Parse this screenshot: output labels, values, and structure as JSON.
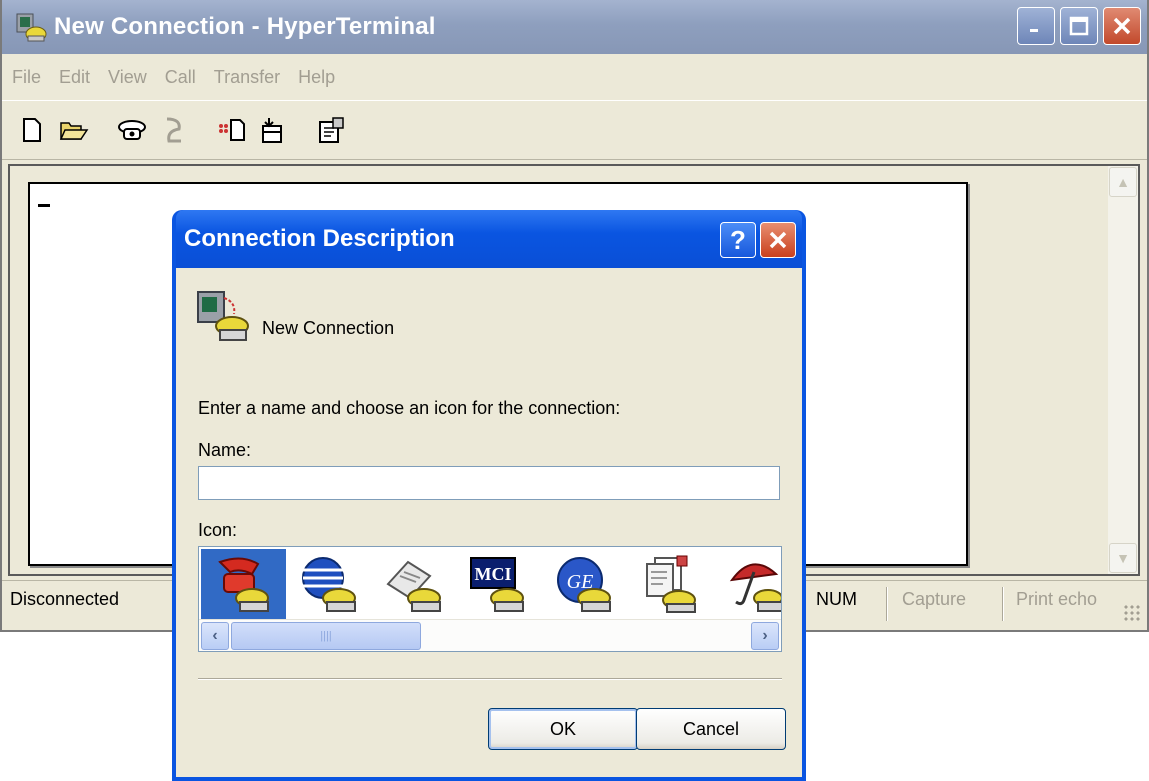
{
  "window": {
    "title": "New Connection - HyperTerminal",
    "menu": [
      "File",
      "Edit",
      "View",
      "Call",
      "Transfer",
      "Help"
    ],
    "status": {
      "connection": "Disconnected",
      "num": "NUM",
      "capture": "Capture",
      "print_echo": "Print echo"
    }
  },
  "toolbar_icons": [
    "new-icon",
    "open-icon",
    "call-icon",
    "disconnect-icon",
    "send-icon",
    "receive-icon",
    "properties-icon"
  ],
  "dialog": {
    "title": "Connection Description",
    "help_button": "?",
    "close_button": "✕",
    "header_label": "New Connection",
    "prompt": "Enter a name and choose an icon for the connection:",
    "name_label": "Name:",
    "name_value": "",
    "icon_label": "Icon:",
    "icons": [
      "phone-icon",
      "globe-icon",
      "fax-icon",
      "mci-icon",
      "ge-icon",
      "documents-icon",
      "umbrella-icon"
    ],
    "icon_mci_text": "MCI",
    "icon_ge_text": "GE",
    "ok": "OK",
    "cancel": "Cancel"
  },
  "colors": {
    "dialog_title_blue": "#0a55e1",
    "inactive_title": "#8e9fbe",
    "face": "#ece9d8"
  }
}
